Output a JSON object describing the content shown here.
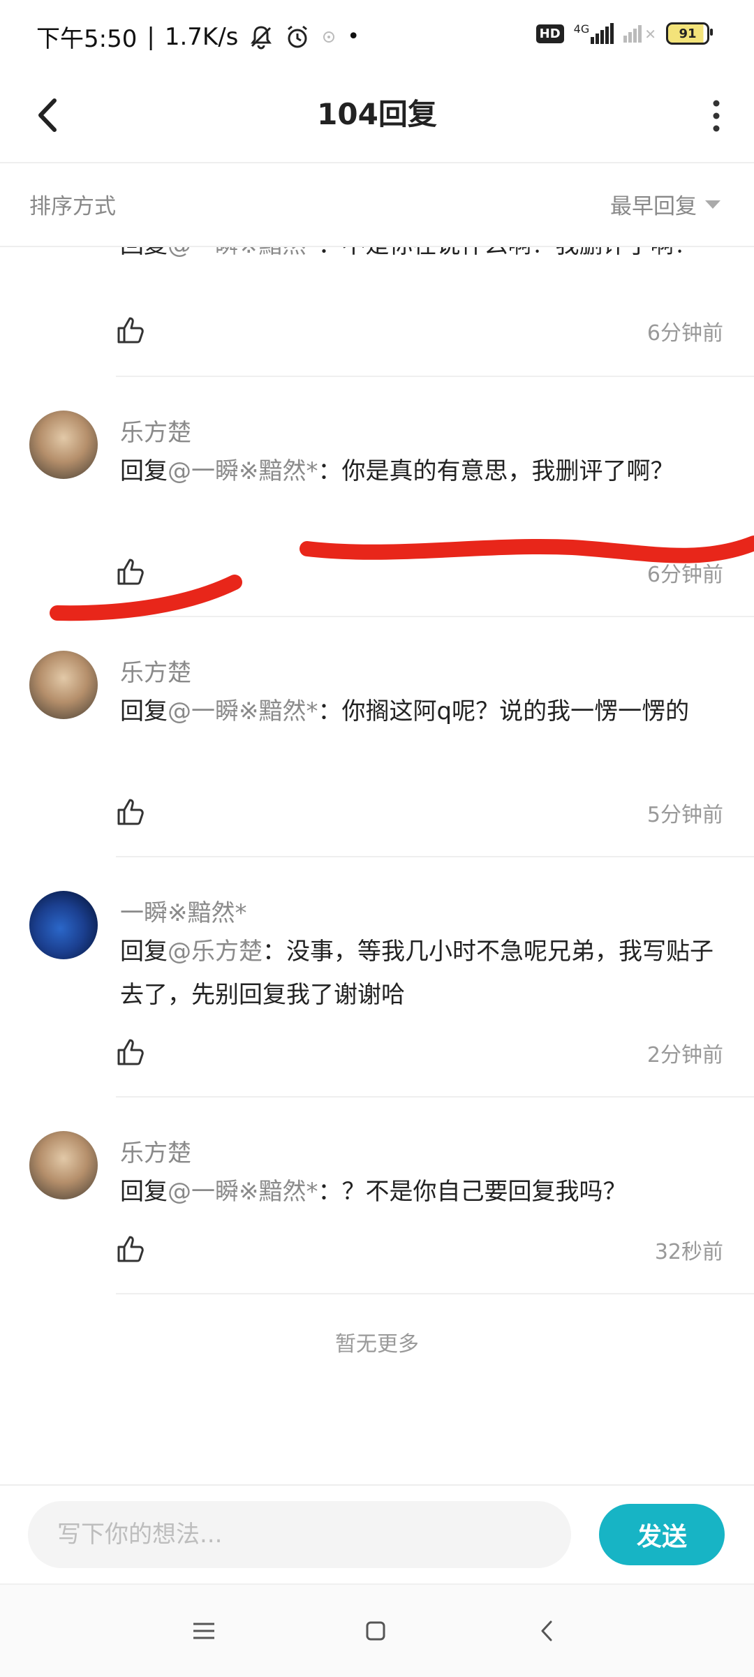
{
  "status_bar": {
    "time": "下午5:50",
    "speed": "1.7K/s",
    "hd": "HD",
    "network": "4G",
    "battery": "91"
  },
  "header": {
    "title": "104回复"
  },
  "sort": {
    "label": "排序方式",
    "value": "最早回复"
  },
  "replies": [
    {
      "name": "",
      "prefix": "回复",
      "mention": "@一瞬※黯然*",
      "text": "：不是你在说什么啊？我删评了啊？",
      "time": "6分钟前",
      "partial": true
    },
    {
      "name": "乐方楚",
      "prefix": "回复",
      "mention": "@一瞬※黯然*",
      "text": "：你是真的有意思，我删评了啊？",
      "time": "6分钟前"
    },
    {
      "name": "乐方楚",
      "prefix": "回复",
      "mention": "@一瞬※黯然*",
      "text": "：你搁这阿q呢？说的我一愣一愣的",
      "time": "5分钟前"
    },
    {
      "name": "一瞬※黯然*",
      "prefix": "回复",
      "mention": "@乐方楚",
      "text": "：没事，等我几小时不急呢兄弟，我写贴子去了，先别回复我了谢谢哈",
      "time": "2分钟前"
    },
    {
      "name": "乐方楚",
      "prefix": "回复",
      "mention": "@一瞬※黯然*",
      "text": "：？不是你自己要回复我吗？",
      "time": "32秒前"
    }
  ],
  "footer_note": "暂无更多",
  "composer": {
    "placeholder": "写下你的想法...",
    "send_label": "发送"
  },
  "colors": {
    "accent": "#17b4c5",
    "scribble": "#e8261a"
  }
}
